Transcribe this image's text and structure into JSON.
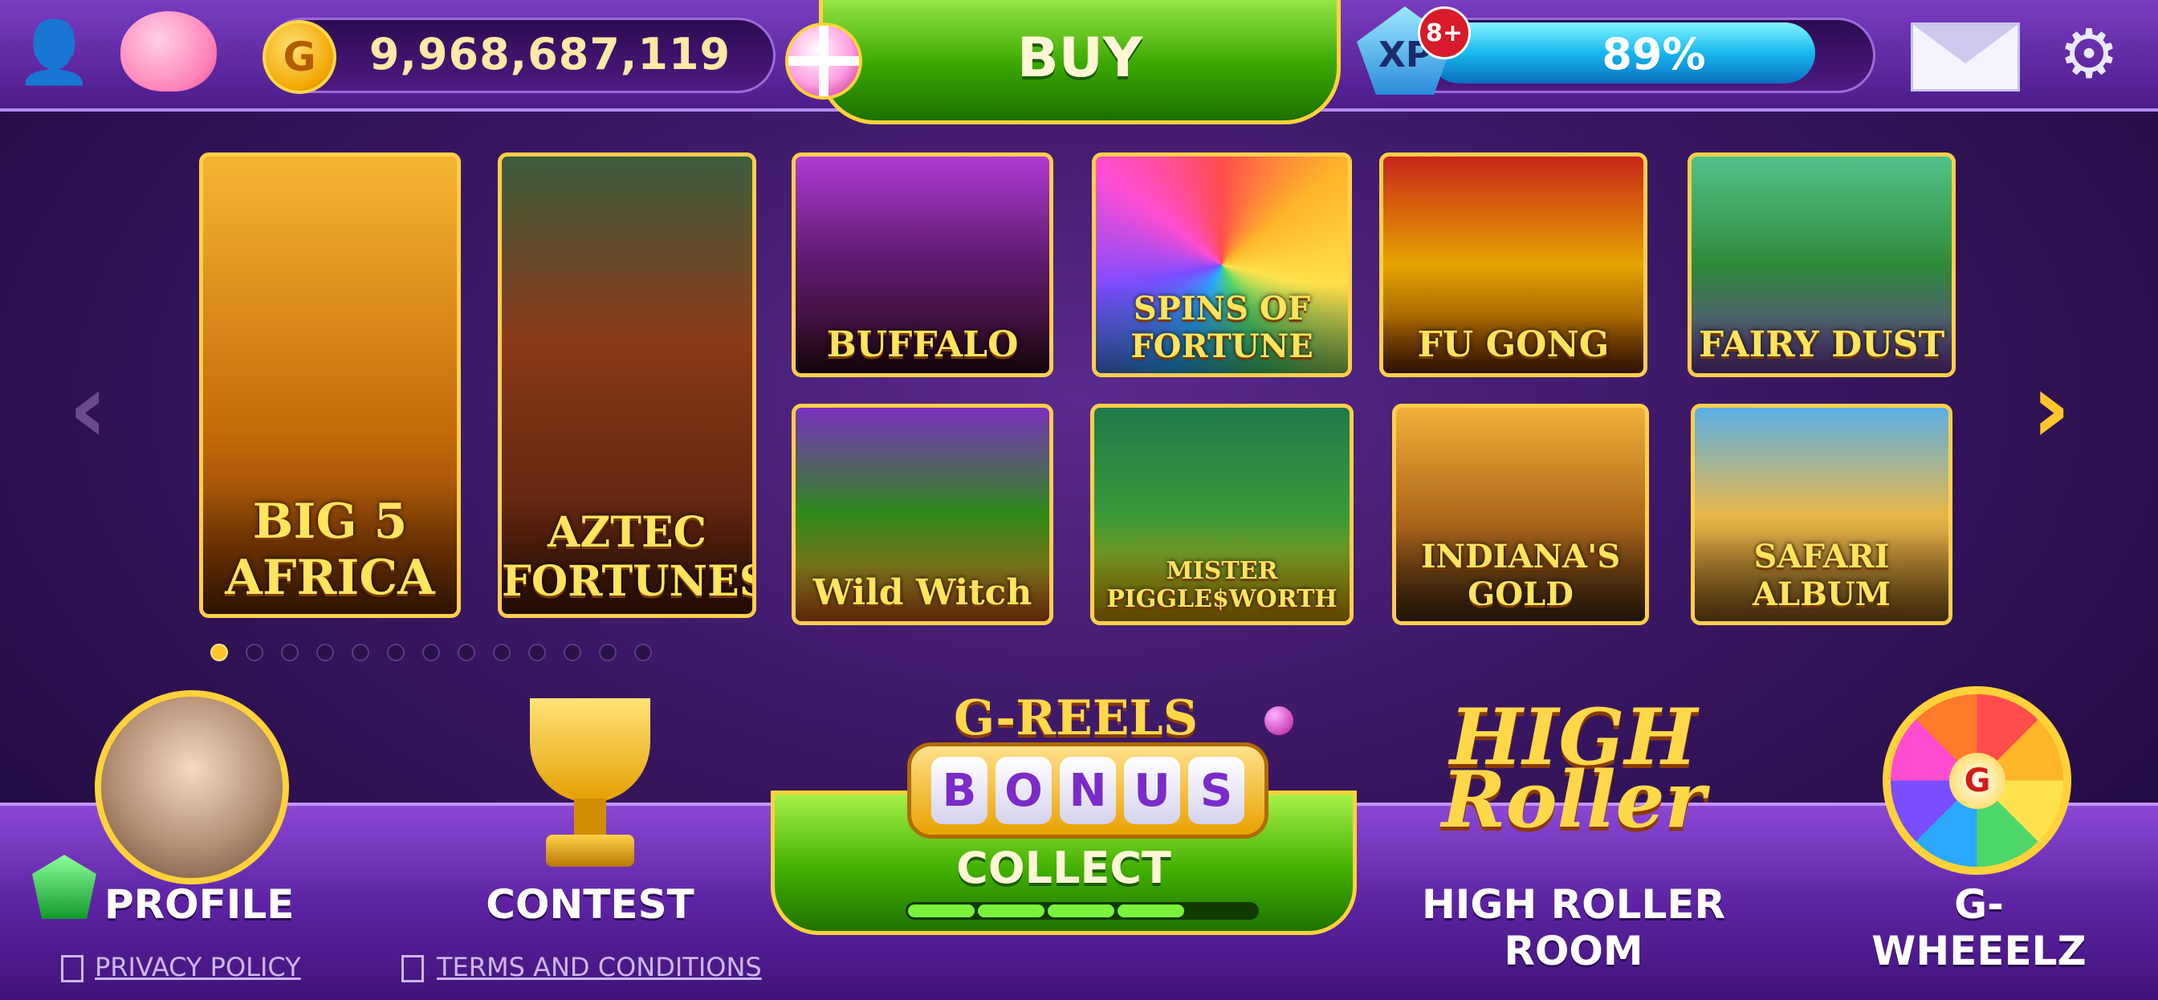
{
  "header": {
    "coins": "9,968,687,119",
    "coin_symbol": "G",
    "buy_label": "BUY",
    "xp_label": "XP",
    "xp_level_badge": "8+",
    "xp_percent": "89%",
    "xp_progress_fraction": 0.89
  },
  "games": [
    {
      "title": "BIG 5 AFRICA"
    },
    {
      "title": "AZTEC FORTUNES"
    },
    {
      "title": "BUFFALO"
    },
    {
      "title": "SPINS OF FORTUNE"
    },
    {
      "title": "FU GONG"
    },
    {
      "title": "FAIRY DUST"
    },
    {
      "title": "Wild Witch"
    },
    {
      "title": "MISTER PIGGLE$WORTH"
    },
    {
      "title": "INDIANA'S GOLD"
    },
    {
      "title": "SAFARI ALBUM"
    }
  ],
  "carousel": {
    "page_count": 13,
    "current_page": 1,
    "prev_arrow": "‹",
    "next_arrow": "›"
  },
  "bottom_nav": {
    "profile_label": "PROFILE",
    "contest_label": "CONTEST",
    "greels_title": "G-REELS",
    "bonus_letters": [
      "B",
      "O",
      "N",
      "U",
      "S"
    ],
    "collect_label": "COLLECT",
    "collect_progress_segments_filled": 4,
    "collect_progress_segments_total": 5,
    "high_roller_logo": "HIGH Roller",
    "high_roller_label": "HIGH ROLLER ROOM",
    "wheel_label": "G-WHEEELZ",
    "wheel_hub": "G"
  },
  "footer": {
    "privacy": "PRIVACY POLICY",
    "terms": "TERMS AND CONDITIONS"
  },
  "icons": {
    "add_user": "add-user-icon",
    "piggy_bank": "piggy-bank-icon",
    "mail": "mail-icon",
    "settings": "gear-icon"
  },
  "colors": {
    "accent_gold": "#ffd23a",
    "buy_green": "#3aa800",
    "xp_blue": "#18b7ef",
    "bg_purple": "#3a1763"
  }
}
